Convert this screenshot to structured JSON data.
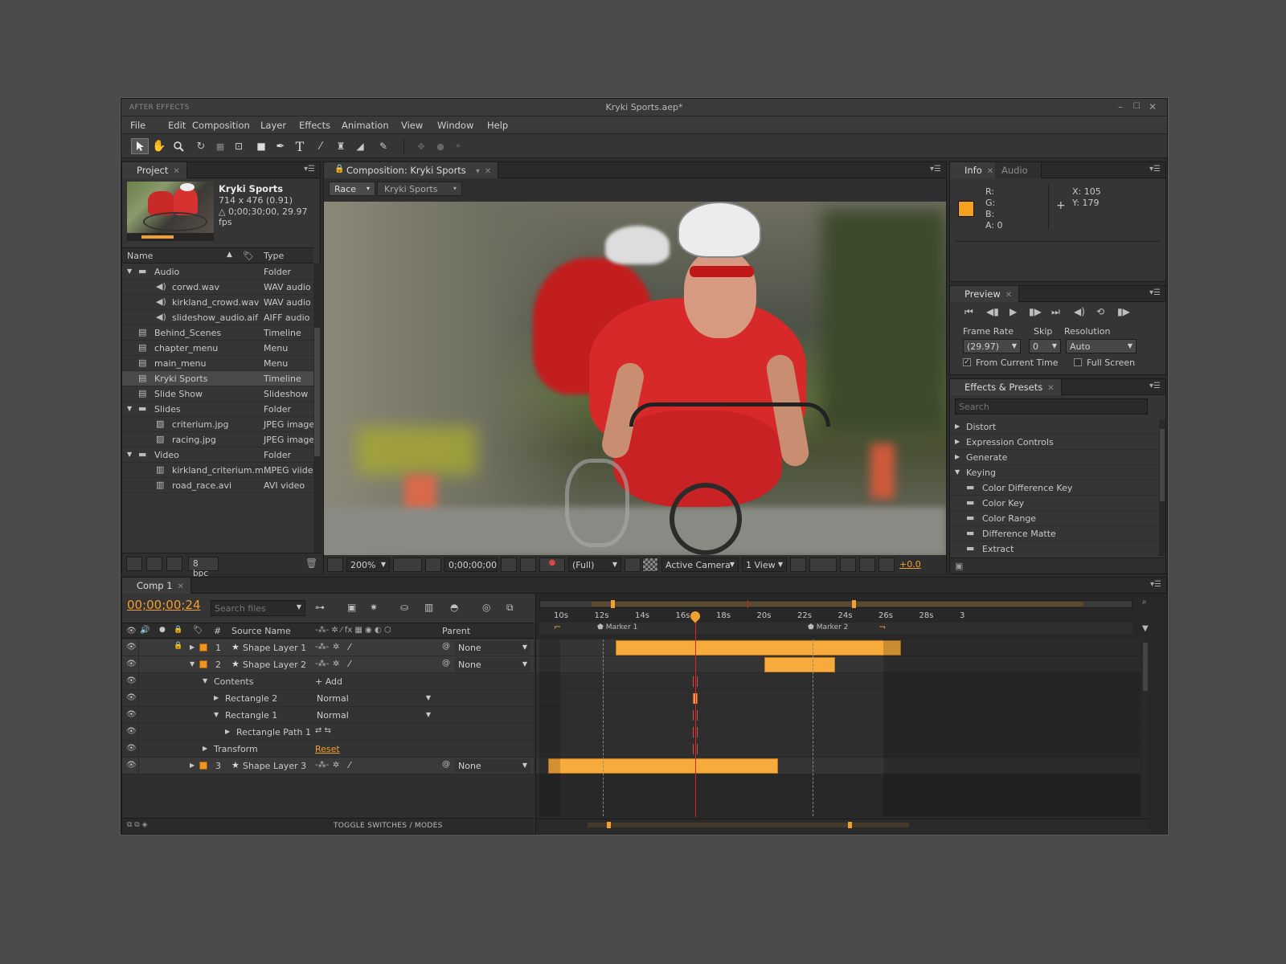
{
  "app": {
    "brand": "AFTER EFFECTS",
    "document_title": "Kryki Sports.aep*"
  },
  "menu": [
    "File",
    "Edit",
    "Composition",
    "Layer",
    "Effects",
    "Animation",
    "View",
    "Window",
    "Help"
  ],
  "project": {
    "tab": "Project",
    "item_name": "Kryki Sports",
    "item_size": "714 x 476 (0.91)",
    "item_duration": "△ 0;00;30;00, 29.97 fps",
    "columns": {
      "name": "Name",
      "type": "Type"
    },
    "rows": [
      {
        "indent": 0,
        "kind": "folder",
        "open": true,
        "name": "Audio",
        "type": "Folder"
      },
      {
        "indent": 1,
        "kind": "audio",
        "name": "corwd.wav",
        "type": "WAV audio"
      },
      {
        "indent": 1,
        "kind": "audio",
        "name": "kirkland_crowd.wav",
        "type": "WAV audio"
      },
      {
        "indent": 1,
        "kind": "audio",
        "name": "slideshow_audio.aif",
        "type": "AIFF audio"
      },
      {
        "indent": 0,
        "kind": "timeline",
        "name": "Behind_Scenes",
        "type": "Timeline"
      },
      {
        "indent": 0,
        "kind": "menu",
        "name": "chapter_menu",
        "type": "Menu"
      },
      {
        "indent": 0,
        "kind": "menu",
        "name": "main_menu",
        "type": "Menu"
      },
      {
        "indent": 0,
        "kind": "timeline",
        "name": "Kryki Sports",
        "type": "Timeline",
        "selected": true
      },
      {
        "indent": 0,
        "kind": "timeline",
        "name": "Slide Show",
        "type": "Slideshow"
      },
      {
        "indent": 0,
        "kind": "folder",
        "open": true,
        "name": "Slides",
        "type": "Folder"
      },
      {
        "indent": 1,
        "kind": "image",
        "name": "criterium.jpg",
        "type": "JPEG image"
      },
      {
        "indent": 1,
        "kind": "image",
        "name": "racing.jpg",
        "type": "JPEG image"
      },
      {
        "indent": 0,
        "kind": "folder",
        "open": true,
        "name": "Video",
        "type": "Folder"
      },
      {
        "indent": 1,
        "kind": "video",
        "name": "kirkland_criterium.m...",
        "type": "MPEG viide"
      },
      {
        "indent": 1,
        "kind": "video",
        "name": "road_race.avi",
        "type": "AVI video"
      }
    ],
    "bpc": "8 bpc"
  },
  "composition": {
    "tab": "Composition: Kryki Sports",
    "crumb_a": "Race",
    "crumb_b": "Kryki Sports",
    "zoom": "200%",
    "timecode": "0;00;00;00",
    "quality": "(Full)",
    "camera": "Active Camera",
    "views": "1 View",
    "exposure": "+0.0"
  },
  "info": {
    "tab": "Info",
    "tab2": "Audio",
    "r": "R:",
    "g": "G:",
    "b": "B:",
    "a": "A: 0",
    "x": "X: 105",
    "y": "Y: 179",
    "swatch": "#f5a01e"
  },
  "preview": {
    "tab": "Preview",
    "frame_rate_label": "Frame Rate",
    "frame_rate": "(29.97)",
    "skip_label": "Skip",
    "skip": "0",
    "resolution_label": "Resolution",
    "resolution": "Auto",
    "from_current": "From Current Time",
    "full_screen": "Full Screen"
  },
  "effects": {
    "tab": "Effects & Presets",
    "search_placeholder": "Search",
    "items": [
      {
        "indent": 0,
        "kind": "group",
        "open": false,
        "name": "Distort"
      },
      {
        "indent": 0,
        "kind": "group",
        "open": false,
        "name": "Expression Controls"
      },
      {
        "indent": 0,
        "kind": "group",
        "open": false,
        "name": "Generate"
      },
      {
        "indent": 0,
        "kind": "group",
        "open": true,
        "name": "Keying"
      },
      {
        "indent": 1,
        "kind": "effect",
        "name": "Color Difference Key"
      },
      {
        "indent": 1,
        "kind": "effect",
        "name": "Color Key"
      },
      {
        "indent": 1,
        "kind": "effect",
        "name": "Color Range"
      },
      {
        "indent": 1,
        "kind": "effect",
        "name": "Difference Matte"
      },
      {
        "indent": 1,
        "kind": "effect",
        "name": "Extract"
      }
    ]
  },
  "timeline": {
    "tab": "Comp 1",
    "timecode": "00;00;00;24",
    "search_placeholder": "Search files",
    "col_num": "#",
    "col_source": "Source Name",
    "col_parent": "Parent",
    "toggle_label": "TOGGLE SWITCHES / MODES",
    "ruler": [
      "10s",
      "12s",
      "14s",
      "16s",
      "18s",
      "20s",
      "22s",
      "24s",
      "26s",
      "28s",
      "3"
    ],
    "markers": [
      "Marker 1",
      "Marker 2"
    ],
    "layers": [
      {
        "num": "1",
        "name": "Shape Layer 1",
        "kind": "layer",
        "open": false,
        "parent": "None",
        "locked": true,
        "bar_start": 0.131,
        "bar_end": 0.604
      },
      {
        "num": "2",
        "name": "Shape Layer 2",
        "kind": "layer",
        "open": true,
        "parent": "None",
        "bar_start": 0.378,
        "bar_end": 0.495
      },
      {
        "name": "Contents",
        "kind": "sub1",
        "open": true,
        "extra": "+ Add"
      },
      {
        "name": "Rectangle 2",
        "kind": "sub2",
        "open": false,
        "mode": "Normal"
      },
      {
        "name": "Rectangle 1",
        "kind": "sub2",
        "open": true,
        "mode": "Normal"
      },
      {
        "name": "Rectangle Path 1",
        "kind": "sub3",
        "open": false
      },
      {
        "name": "Transform",
        "kind": "sub1",
        "open": false,
        "reset": "Reset"
      },
      {
        "num": "3",
        "name": "Shape Layer 3",
        "kind": "layer",
        "open": false,
        "parent": "None",
        "bar_start": 0.02,
        "bar_end": 0.4
      }
    ]
  }
}
